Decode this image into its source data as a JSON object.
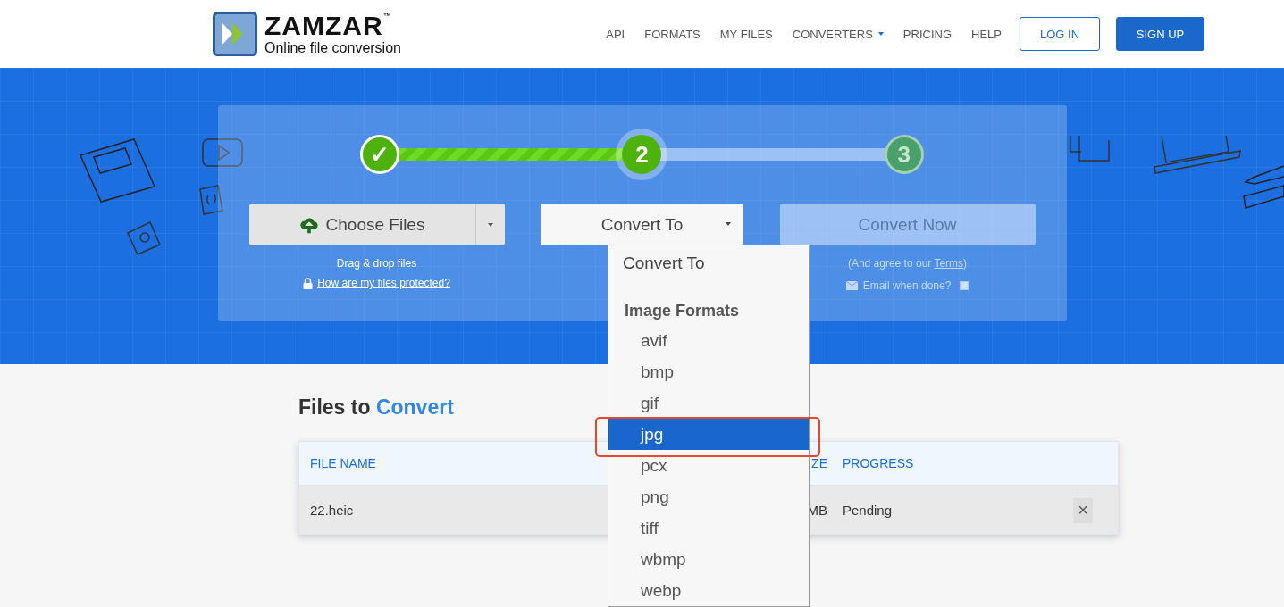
{
  "header": {
    "logo": {
      "name": "ZAMZAR",
      "tm": "™",
      "tagline": "Online file conversion"
    },
    "nav": [
      {
        "label": "API",
        "dropdown": false
      },
      {
        "label": "FORMATS",
        "dropdown": false
      },
      {
        "label": "MY FILES",
        "dropdown": false
      },
      {
        "label": "CONVERTERS",
        "dropdown": true
      },
      {
        "label": "PRICING",
        "dropdown": false
      },
      {
        "label": "HELP",
        "dropdown": false
      }
    ],
    "buttons": [
      {
        "label": "LOG IN",
        "kind": "outline"
      },
      {
        "label": "SIGN UP",
        "kind": "solid"
      }
    ]
  },
  "steps": [
    {
      "label": "✓",
      "completed": true,
      "current": false
    },
    {
      "label": "2",
      "completed": false,
      "current": true
    },
    {
      "label": "3",
      "completed": false,
      "current": false
    }
  ],
  "step_tracks": [
    {
      "level": 1
    },
    {
      "level": 0
    }
  ],
  "choose": {
    "label": "Choose Files",
    "hint": "Drag & drop files",
    "link": "How are my files protected?"
  },
  "convert_to": {
    "label": "Convert To",
    "expanded": true
  },
  "convert_now": {
    "label": "Convert Now",
    "disabled": true,
    "note_before": "(And agree to our ",
    "note_link": "Terms",
    "note_after": ")",
    "email": {
      "label": "Email when done?",
      "checked": false
    }
  },
  "dropdown": {
    "placeholder": "Convert To",
    "group": "Image Formats",
    "options": [
      {
        "label": "avif",
        "selected": false
      },
      {
        "label": "bmp",
        "selected": false
      },
      {
        "label": "gif",
        "selected": false
      },
      {
        "label": "jpg",
        "selected": true
      },
      {
        "label": "pcx",
        "selected": false
      },
      {
        "label": "png",
        "selected": false
      },
      {
        "label": "tiff",
        "selected": false
      },
      {
        "label": "wbmp",
        "selected": false
      },
      {
        "label": "webp",
        "selected": false
      }
    ]
  },
  "files": {
    "title_plain": "Files to ",
    "title_accent": "Convert",
    "columns": [
      "FILE NAME",
      "ZE",
      "PROGRESS"
    ],
    "rows": [
      {
        "cells": [
          "22.heic",
          "MB",
          "Pending"
        ],
        "remove": "×"
      }
    ]
  }
}
